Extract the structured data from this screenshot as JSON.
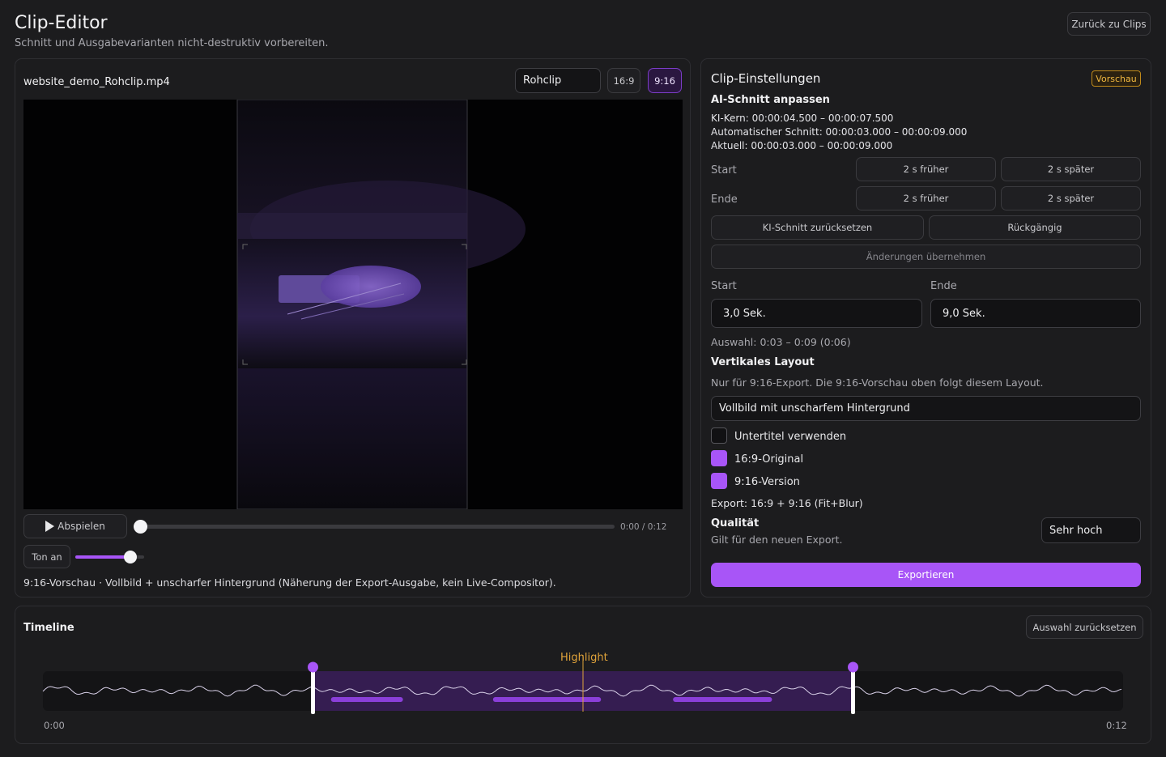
{
  "header": {
    "title": "Clip-Editor",
    "subtitle": "Schnitt und Ausgabevarianten nicht-destruktiv vorbereiten.",
    "back_button": "Zurück zu Clips"
  },
  "preview": {
    "filename": "website_demo_Rohclip.mp4",
    "source_select": "Rohclip",
    "aspect_16_9": "16:9",
    "aspect_9_16": "9:16",
    "active_aspect": "9:16",
    "play_label": "Abspielen",
    "time_display": "0:00 / 0:12",
    "playback_progress": 0.0,
    "sound_label": "Ton an",
    "volume": 0.8,
    "caption": "9:16-Vorschau · Vollbild + unscharfer Hintergrund (Näherung der Export-Ausgabe, kein Live-Compositor)."
  },
  "settings": {
    "title": "Clip-Einstellungen",
    "badge": "Vorschau",
    "ai_section_title": "AI-Schnitt anpassen",
    "ki_core": "KI-Kern: 00:00:04.500 – 00:00:07.500",
    "auto_cut": "Automatischer Schnitt: 00:00:03.000 – 00:00:09.000",
    "current": "Aktuell: 00:00:03.000 – 00:00:09.000",
    "start_label": "Start",
    "end_label": "Ende",
    "earlier": "2 s früher",
    "later": "2 s später",
    "reset_ai": "KI-Schnitt zurücksetzen",
    "undo": "Rückgängig",
    "apply": "Änderungen übernehmen",
    "start_field_label": "Start",
    "end_field_label": "Ende",
    "start_value": "3,0 Sek.",
    "end_value": "9,0 Sek.",
    "selection_info": "Auswahl: 0:03 – 0:09 (0:06)",
    "vertical_title": "Vertikales Layout",
    "vertical_hint": "Nur für 9:16-Export. Die 9:16-Vorschau oben folgt diesem Layout.",
    "layout_select": "Vollbild mit unscharfem Hintergrund",
    "subtitles_label": "Untertitel verwenden",
    "subtitles_checked": false,
    "orig_label": "16:9-Original",
    "orig_checked": true,
    "vertical_label": "9:16-Version",
    "vertical_checked": true,
    "export_summary": "Export: 16:9 + 9:16 (Fit+Blur)",
    "quality_title": "Qualität",
    "quality_hint": "Gilt für den neuen Export.",
    "quality_value": "Sehr hoch",
    "export_button": "Exportieren"
  },
  "timeline": {
    "title": "Timeline",
    "reset_button": "Auswahl zurücksetzen",
    "highlight_label": "Highlight",
    "start_time": "0:00",
    "end_time": "0:12",
    "duration_s": 12,
    "selection_start_s": 3,
    "selection_end_s": 9,
    "highlight_s": 6,
    "segments_s": [
      [
        3.2,
        4.0
      ],
      [
        5.0,
        6.2
      ],
      [
        7.0,
        8.1
      ]
    ]
  },
  "colors": {
    "accent": "#a855f7",
    "accent_dark": "#3b1f5c",
    "highlight": "#e0a33a",
    "badge_border": "#c08a1a"
  }
}
